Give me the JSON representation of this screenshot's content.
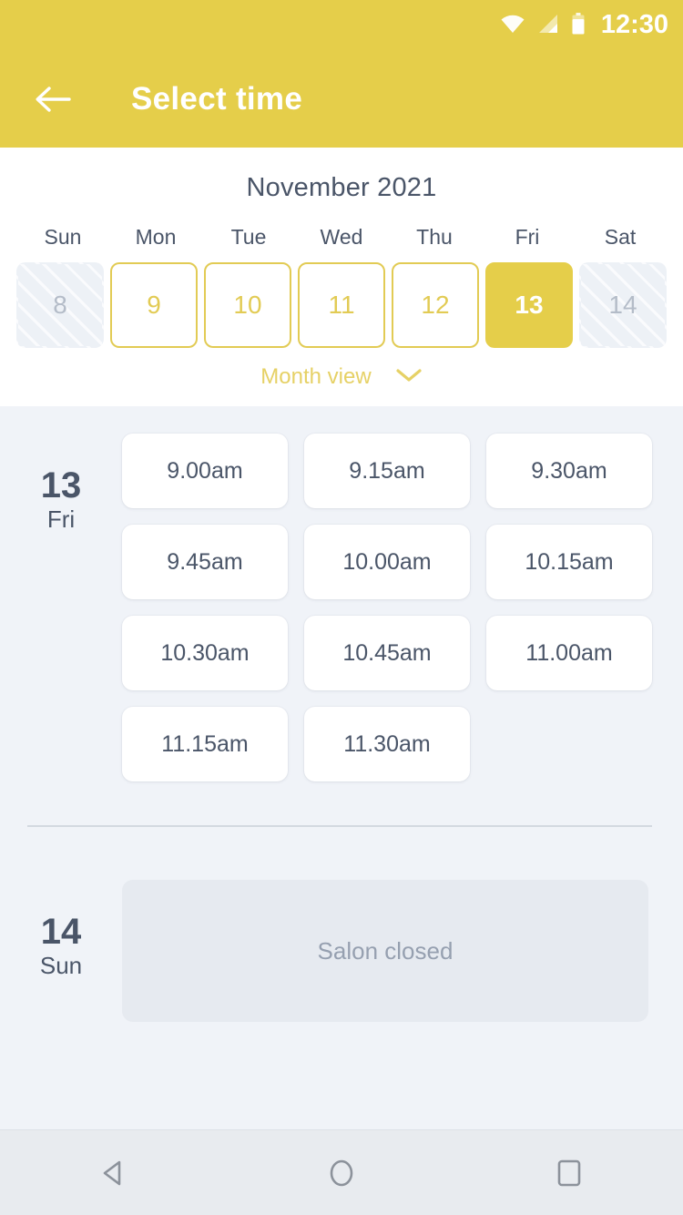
{
  "status_bar": {
    "time": "12:30",
    "icons": [
      "wifi-icon",
      "cellular-signal-icon",
      "battery-icon"
    ]
  },
  "app_bar": {
    "back_icon": "back-arrow-icon",
    "title": "Select time"
  },
  "calendar": {
    "month_label": "November 2021",
    "weekdays": [
      "Sun",
      "Mon",
      "Tue",
      "Wed",
      "Thu",
      "Fri",
      "Sat"
    ],
    "days": [
      {
        "num": "8",
        "state": "disabled"
      },
      {
        "num": "9",
        "state": "available"
      },
      {
        "num": "10",
        "state": "available"
      },
      {
        "num": "11",
        "state": "available"
      },
      {
        "num": "12",
        "state": "available"
      },
      {
        "num": "13",
        "state": "selected"
      },
      {
        "num": "14",
        "state": "disabled"
      }
    ],
    "month_view_label": "Month view",
    "month_view_icon": "chevron-down-icon"
  },
  "slots": {
    "day_13": {
      "date_num": "13",
      "day_of_week": "Fri",
      "times": [
        "9.00am",
        "9.15am",
        "9.30am",
        "9.45am",
        "10.00am",
        "10.15am",
        "10.30am",
        "10.45am",
        "11.00am",
        "11.15am",
        "11.30am"
      ]
    },
    "day_14": {
      "date_num": "14",
      "day_of_week": "Sun",
      "closed_message": "Salon closed"
    }
  },
  "nav_bar": {
    "back": "nav-back-icon",
    "home": "nav-home-icon",
    "recents": "nav-recents-icon"
  },
  "colors": {
    "accent": "#E5CE4A",
    "accent_border": "#E2CB54",
    "text_dark": "#4A5568",
    "text_muted": "#96A0B0",
    "background": "#F0F3F8",
    "surface": "#FFFFFF",
    "closed_surface": "#E6EAF0"
  }
}
